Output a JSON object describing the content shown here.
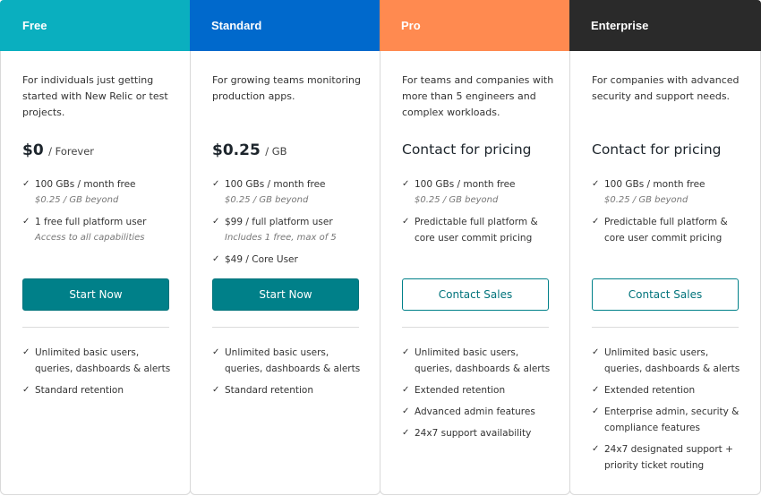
{
  "plans": [
    {
      "name": "Free",
      "header_color": "#0aafbf",
      "description": "For individuals just getting started with New Relic or test projects.",
      "price_amount": "$0",
      "price_unit": "/ Forever",
      "price_contact": null,
      "features_top": [
        {
          "text": "100 GBs / month free",
          "sub": "$0.25 / GB beyond"
        },
        {
          "text": "1 free full platform user",
          "sub": "Access to all capabilities"
        }
      ],
      "button_label": "Start Now",
      "button_style": "primary",
      "features_bottom": [
        {
          "text": "Unlimited basic users, queries, dashboards & alerts"
        },
        {
          "text": "Standard retention"
        }
      ]
    },
    {
      "name": "Standard",
      "header_color": "#0069cc",
      "description": "For growing teams monitoring production apps.",
      "price_amount": "$0.25",
      "price_unit": "/ GB",
      "price_contact": null,
      "features_top": [
        {
          "text": "100 GBs / month free",
          "sub": "$0.25 / GB beyond"
        },
        {
          "text": "$99 / full platform user",
          "sub": "Includes 1 free, max of 5"
        },
        {
          "text": "$49 / Core User",
          "sub": null
        }
      ],
      "button_label": "Start Now",
      "button_style": "primary",
      "features_bottom": [
        {
          "text": "Unlimited basic users, queries, dashboards & alerts"
        },
        {
          "text": "Standard retention"
        }
      ]
    },
    {
      "name": "Pro",
      "header_color": "#ff8a50",
      "description": "For teams and companies with more than 5 engineers and complex workloads.",
      "price_amount": null,
      "price_unit": null,
      "price_contact": "Contact for pricing",
      "features_top": [
        {
          "text": "100 GBs / month free",
          "sub": "$0.25 / GB beyond"
        },
        {
          "text": "Predictable full platform & core user commit pricing",
          "sub": null
        }
      ],
      "button_label": "Contact Sales",
      "button_style": "outline",
      "features_bottom": [
        {
          "text": "Unlimited basic users, queries, dashboards & alerts"
        },
        {
          "text": "Extended retention"
        },
        {
          "text": "Advanced admin features"
        },
        {
          "text": "24x7 support availability"
        }
      ]
    },
    {
      "name": "Enterprise",
      "header_color": "#2a2a2a",
      "description": "For companies with advanced security and support needs.",
      "price_amount": null,
      "price_unit": null,
      "price_contact": "Contact for pricing",
      "features_top": [
        {
          "text": "100 GBs / month free",
          "sub": "$0.25 / GB beyond"
        },
        {
          "text": "Predictable full platform & core user commit pricing",
          "sub": null
        }
      ],
      "button_label": "Contact Sales",
      "button_style": "outline",
      "features_bottom": [
        {
          "text": "Unlimited basic users, queries, dashboards & alerts"
        },
        {
          "text": "Extended retention"
        },
        {
          "text": "Enterprise admin, security & compliance features"
        },
        {
          "text": "24x7 designated support + priority ticket routing"
        }
      ]
    }
  ],
  "icons": {
    "check": "✓"
  }
}
